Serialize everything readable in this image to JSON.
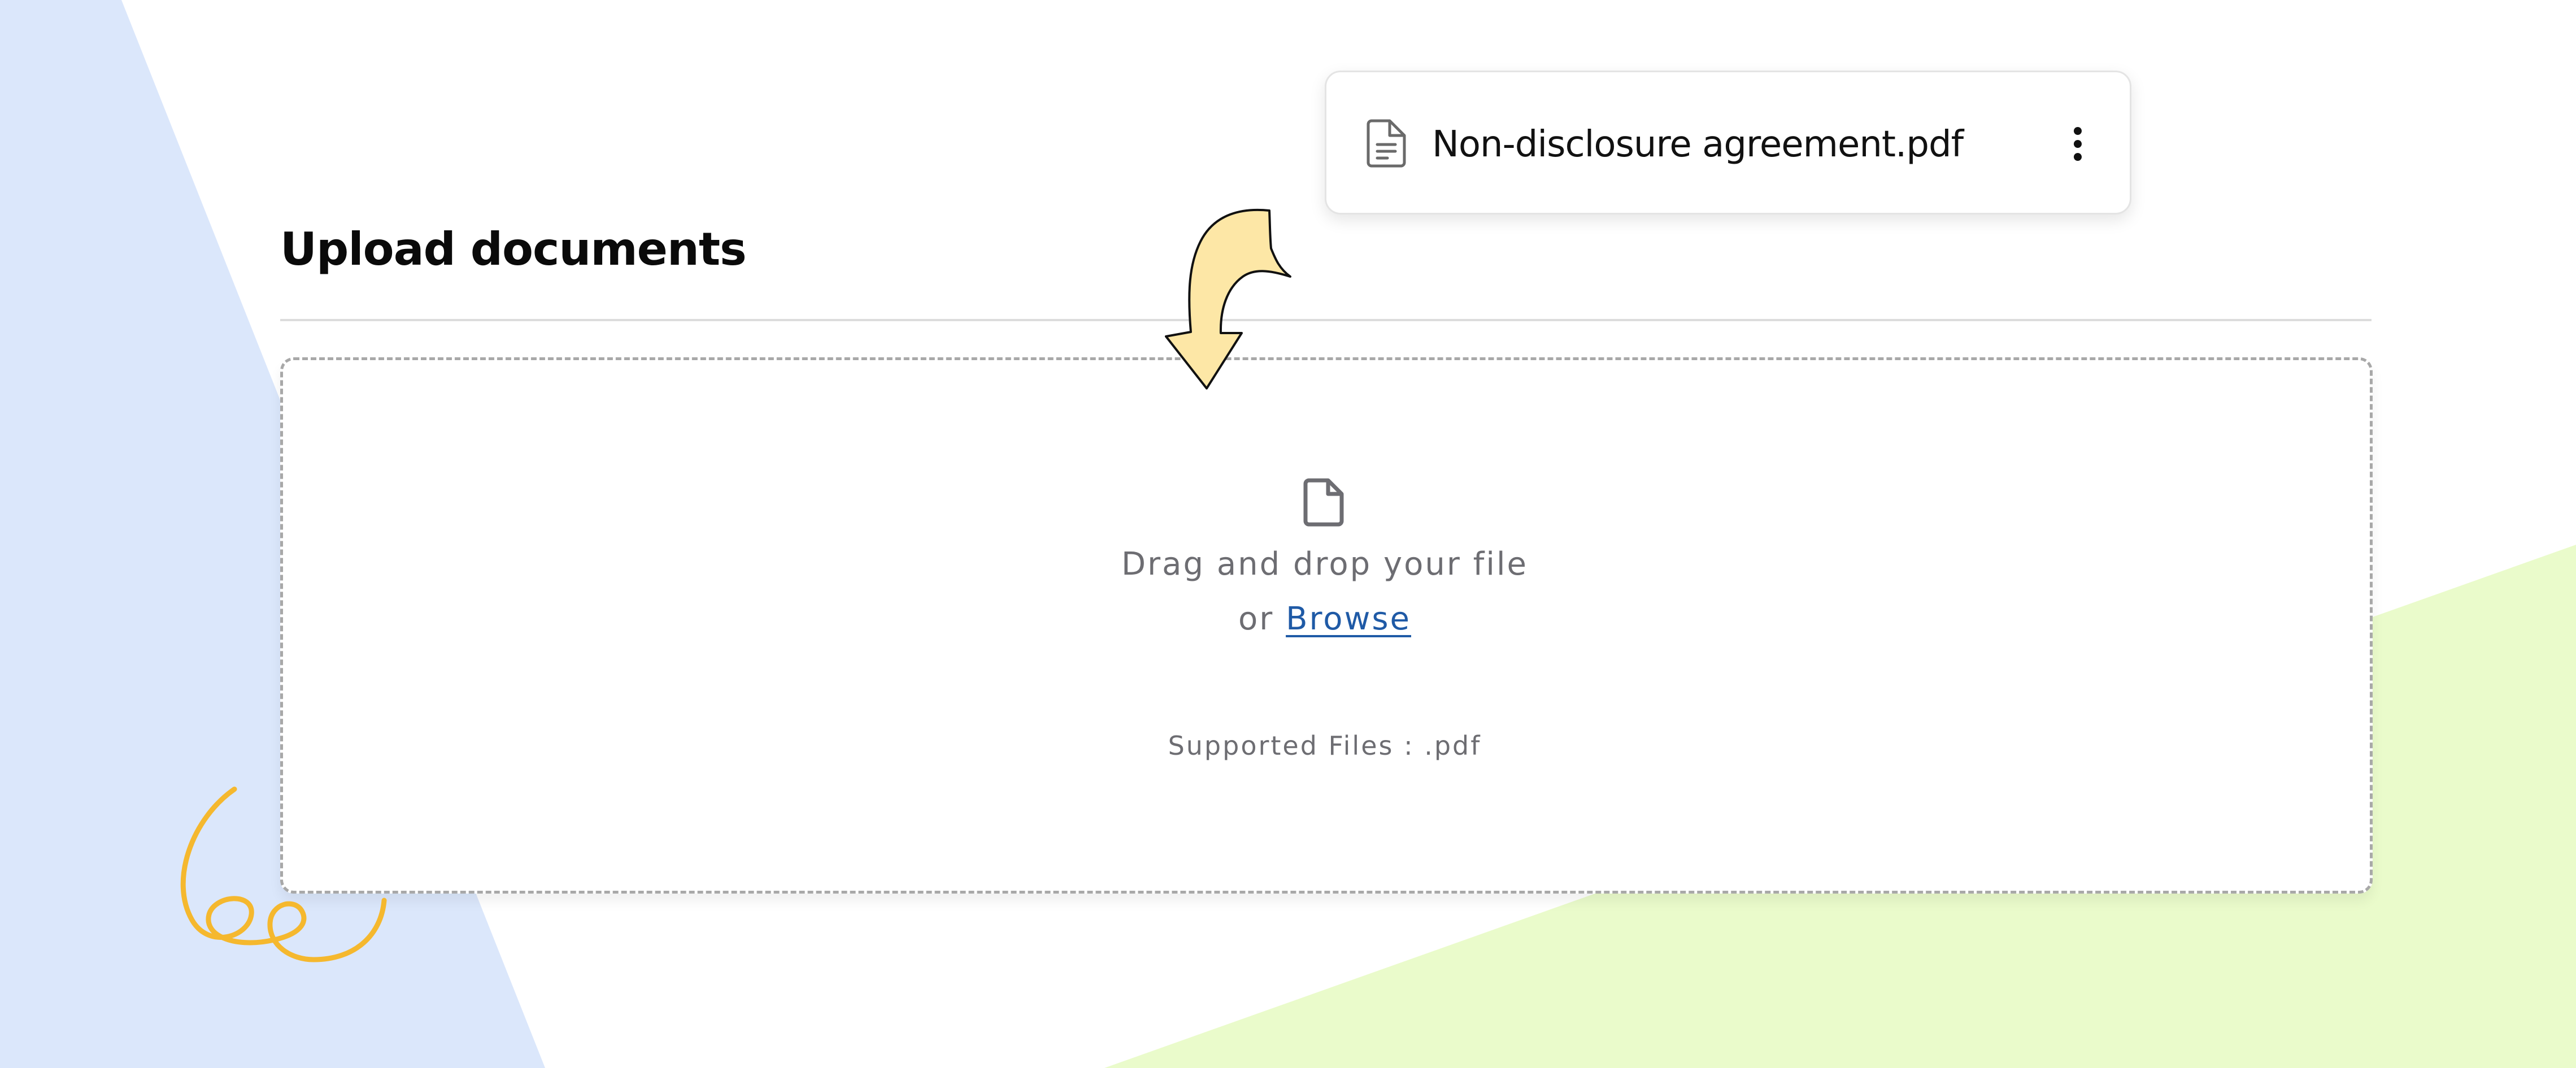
{
  "page": {
    "title": "Upload documents"
  },
  "dropzone": {
    "line1": "Drag and drop your file",
    "or_text": "or ",
    "browse_label": "Browse",
    "supported": "Supported Files : .pdf"
  },
  "file_card": {
    "filename": "Non-disclosure agreement.pdf"
  },
  "icons": {
    "dropzone_icon": "file-icon",
    "file_card_icon": "document-text-icon",
    "menu_icon": "more-vertical-icon",
    "arrow": "curved-arrow-down",
    "decoration": "squiggle"
  },
  "colors": {
    "left_background": "#dbe7fb",
    "right_background": "#eafbcb",
    "link": "#1f5aa6",
    "arrow_fill": "#fde7a6",
    "squiggle": "#f5b82e",
    "muted_text": "#6d6d72"
  }
}
